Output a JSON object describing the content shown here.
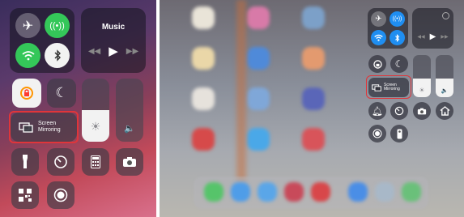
{
  "left_panel": {
    "music": {
      "title": "Music"
    },
    "screen_mirroring": {
      "line1": "Screen",
      "line2": "Mirroring"
    }
  },
  "right_panel": {
    "screen_mirroring": {
      "line1": "Screen",
      "line2": "Mirroring"
    }
  },
  "colors": {
    "active_green": "#34c759",
    "active_blue": "#1f8ef1",
    "active_orange": "#ff9500",
    "highlight_red": "#e0353a"
  },
  "icons": [
    "airplane-icon",
    "cellular-icon",
    "wifi-icon",
    "bluetooth-icon",
    "rewind-icon",
    "play-icon",
    "forward-icon",
    "orientation-lock-icon",
    "moon-icon",
    "screen-mirroring-icon",
    "brightness-icon",
    "volume-icon",
    "flashlight-icon",
    "timer-icon",
    "calculator-icon",
    "camera-icon",
    "qr-code-icon",
    "record-icon",
    "bell-icon",
    "remote-icon",
    "home-icon"
  ],
  "levels": {
    "left_brightness": 0.5,
    "left_volume": 0.0,
    "right_brightness": 0.45,
    "right_volume": 0.45
  }
}
